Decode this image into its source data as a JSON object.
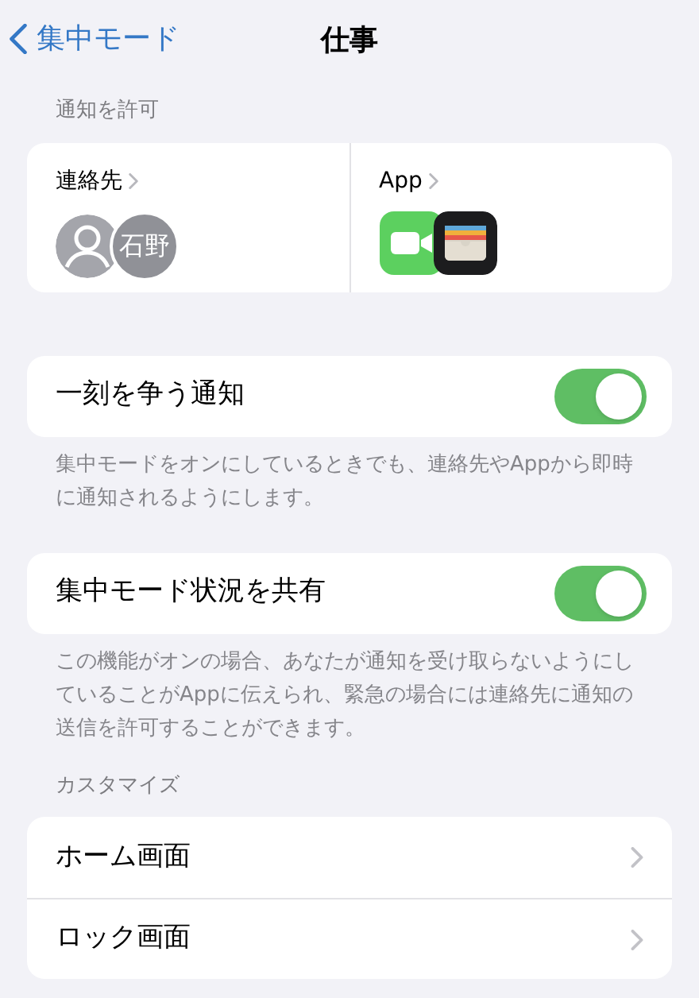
{
  "nav": {
    "back": "集中モード",
    "title": "仕事"
  },
  "allow": {
    "header": "通知を許可",
    "contacts": {
      "label": "連絡先",
      "avatars": [
        {
          "kind": "silhouette"
        },
        {
          "kind": "initials",
          "text": "石野"
        }
      ]
    },
    "apps": {
      "label": "App",
      "icons": [
        {
          "kind": "video"
        },
        {
          "kind": "wallet"
        }
      ]
    }
  },
  "toggles": [
    {
      "label": "一刻を争う通知",
      "on": true,
      "footer": "集中モードをオンにしているときでも、連絡先やAppから即時に通知されるようにします。"
    },
    {
      "label": "集中モード状況を共有",
      "on": true,
      "footer": "この機能がオンの場合、あなたが通知を受け取らないようにしていることがAppに伝えられ、緊急の場合には連絡先に通知の送信を許可することができます。"
    }
  ],
  "customize": {
    "header": "カスタマイズ",
    "items": [
      "ホーム画面",
      "ロック画面"
    ]
  }
}
